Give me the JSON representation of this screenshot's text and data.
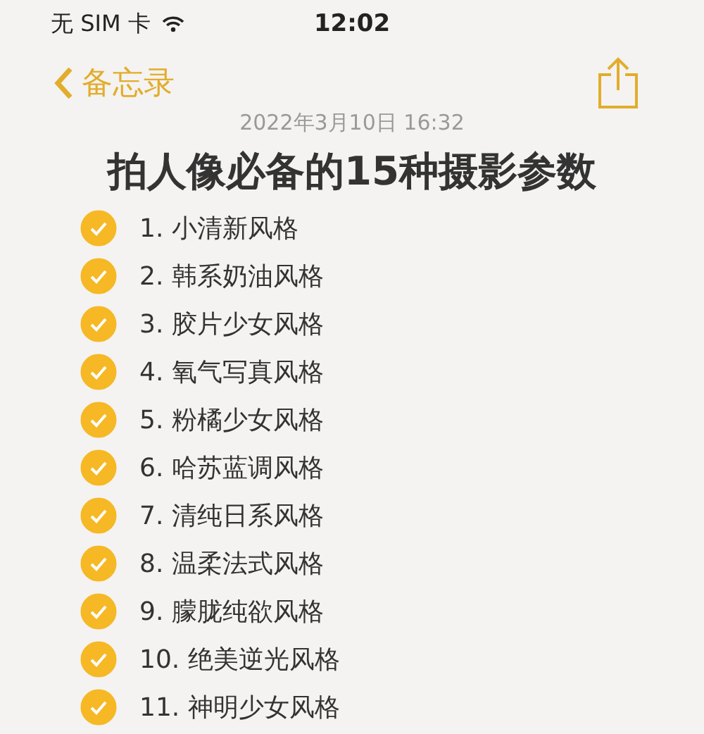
{
  "status_bar": {
    "carrier": "无 SIM 卡",
    "time": "12:02"
  },
  "nav": {
    "back_label": "备忘录"
  },
  "note": {
    "date": "2022年3月10日 16:32",
    "title": "拍人像必备的15种摄影参数",
    "items": [
      {
        "text": "1. 小清新风格",
        "checked": true
      },
      {
        "text": "2. 韩系奶油风格",
        "checked": true
      },
      {
        "text": "3. 胶片少女风格",
        "checked": true
      },
      {
        "text": "4. 氧气写真风格",
        "checked": true
      },
      {
        "text": "5. 粉橘少女风格",
        "checked": true
      },
      {
        "text": "6. 哈苏蓝调风格",
        "checked": true
      },
      {
        "text": "7. 清纯日系风格",
        "checked": true
      },
      {
        "text": "8. 温柔法式风格",
        "checked": true
      },
      {
        "text": "9. 朦胧纯欲风格",
        "checked": true
      },
      {
        "text": "10. 绝美逆光风格",
        "checked": true
      },
      {
        "text": "11. 神明少女风格",
        "checked": true
      }
    ]
  }
}
